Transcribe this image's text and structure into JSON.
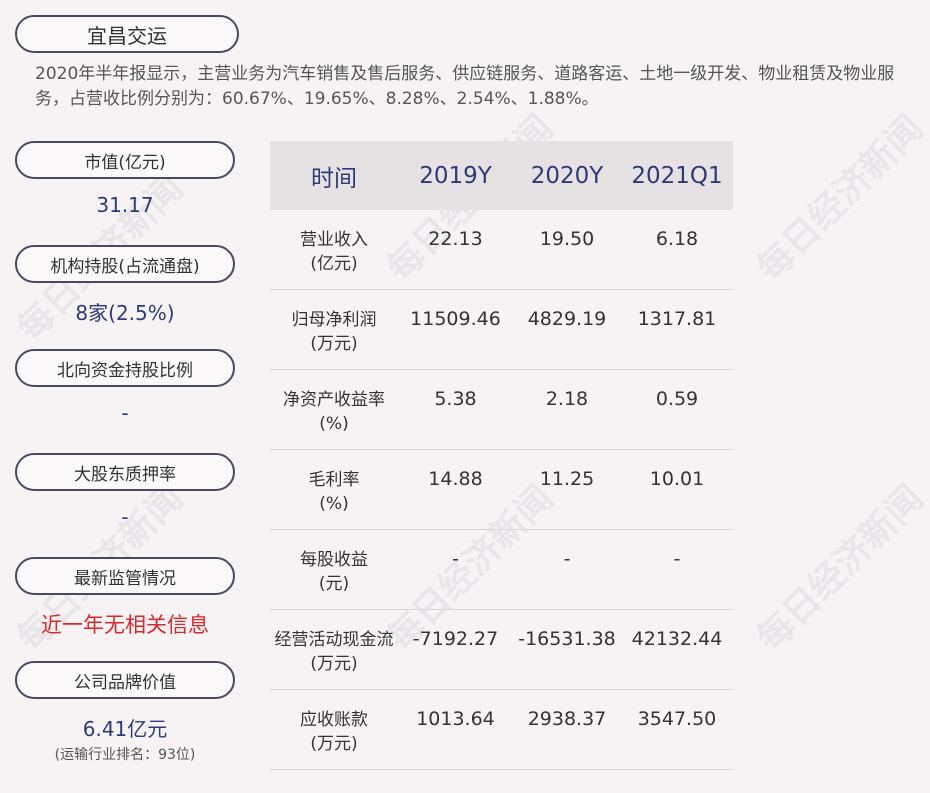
{
  "title": "宜昌交运",
  "description": "2020年半年报显示，主营业务为汽车销售及售后服务、供应链服务、道路客运、土地一级开发、物业租赁及物业服务，占营收比例分别为：60.67%、19.65%、8.28%、2.54%、1.88%。",
  "sidebar": {
    "market_cap_label": "市值(亿元)",
    "market_cap_value": "31.17",
    "institution_label": "机构持股(占流通盘)",
    "institution_value": "8家(2.5%)",
    "northbound_label": "北向资金持股比例",
    "northbound_value": "-",
    "pledge_label": "大股东质押率",
    "pledge_value": "-",
    "regulation_label": "最新监管情况",
    "regulation_value": "近一年无相关信息",
    "brand_label": "公司品牌价值",
    "brand_value": "6.41亿元",
    "brand_rank": "(运输行业排名：93位)"
  },
  "table": {
    "headers": [
      "时间",
      "2019Y",
      "2020Y",
      "2021Q1"
    ],
    "rows": [
      {
        "label1": "营业收入",
        "label2": "(亿元)",
        "v": [
          "22.13",
          "19.50",
          "6.18"
        ]
      },
      {
        "label1": "归母净利润",
        "label2": "(万元)",
        "v": [
          "11509.46",
          "4829.19",
          "1317.81"
        ]
      },
      {
        "label1": "净资产收益率",
        "label2": "(%)",
        "v": [
          "5.38",
          "2.18",
          "0.59"
        ]
      },
      {
        "label1": "毛利率",
        "label2": "(%)",
        "v": [
          "14.88",
          "11.25",
          "10.01"
        ]
      },
      {
        "label1": "每股收益",
        "label2": "(元)",
        "v": [
          "-",
          "-",
          "-"
        ]
      },
      {
        "label1": "经营活动现金流",
        "label2": "(万元)",
        "v": [
          "-7192.27",
          "-16531.38",
          "42132.44"
        ]
      },
      {
        "label1": "应收账款",
        "label2": "(万元)",
        "v": [
          "1013.64",
          "2938.37",
          "3547.50"
        ]
      }
    ]
  },
  "watermark": "每日经济新闻"
}
